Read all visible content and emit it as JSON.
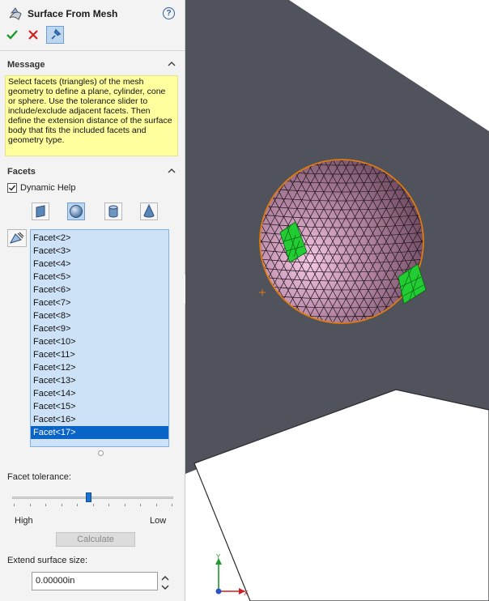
{
  "property_manager": {
    "title": "Surface From Mesh",
    "message_section": {
      "title": "Message",
      "text": "Select facets (triangles) of the mesh geometry to define a plane, cylinder, cone or sphere.  Use the tolerance slider to include/exclude adjacent facets.  Then define the extension distance of the surface body that fits the included facets and geometry type."
    },
    "facets_section": {
      "title": "Facets",
      "dynamic_help_label": "Dynamic Help",
      "dynamic_help_checked": true,
      "shape_buttons": [
        "plane",
        "sphere",
        "cylinder",
        "cone"
      ],
      "active_shape": "sphere",
      "facet_list": [
        "Facet<2>",
        "Facet<3>",
        "Facet<4>",
        "Facet<5>",
        "Facet<6>",
        "Facet<7>",
        "Facet<8>",
        "Facet<9>",
        "Facet<10>",
        "Facet<11>",
        "Facet<12>",
        "Facet<13>",
        "Facet<14>",
        "Facet<15>",
        "Facet<16>",
        "Facet<17>"
      ],
      "selected_facet": "Facet<17>",
      "tolerance_label": "Facet tolerance:",
      "slider_high_label": "High",
      "slider_low_label": "Low",
      "slider_value_fraction": 0.47,
      "calculate_label": "Calculate",
      "extend_label": "Extend surface size:",
      "extend_value": "0.00000in"
    }
  },
  "colors": {
    "panel_bg": "#f3f3f3",
    "message_bg": "#ffff9e",
    "list_bg": "#cde2f6",
    "list_selected": "#0a64c8",
    "sphere_fill": "#b98aa8",
    "selected_facets": "#22cc33",
    "dark_plane": "#50525c",
    "outline_orange": "#e07b10"
  },
  "icons": [
    "surface-from-mesh-icon",
    "help-icon",
    "ok-check-icon",
    "cancel-x-icon",
    "pushpin-icon",
    "chevron-up-icon",
    "facet-select-icon",
    "plane-shape-icon",
    "sphere-shape-icon",
    "cylinder-shape-icon",
    "cone-shape-icon",
    "spin-up-icon",
    "spin-down-icon",
    "triad-icon"
  ]
}
